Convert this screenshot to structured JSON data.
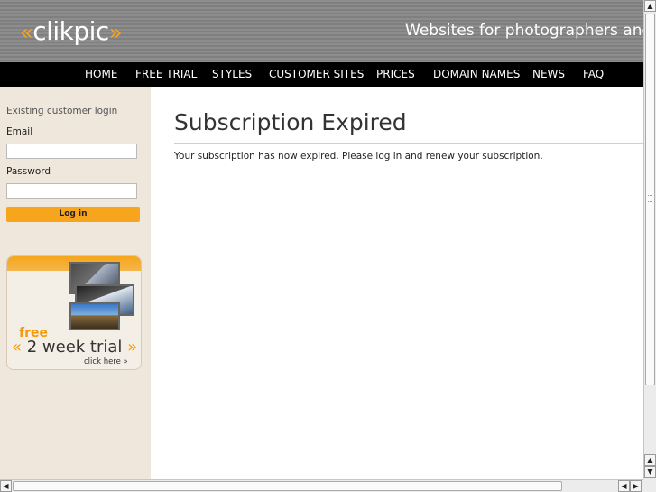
{
  "header": {
    "logo_open": "«",
    "logo_text": "clikpic",
    "logo_close": "»",
    "tagline": "Websites for photographers and"
  },
  "nav": [
    "HOME",
    "FREE TRIAL",
    "STYLES",
    "CUSTOMER SITES",
    "PRICES",
    "DOMAIN NAMES",
    "NEWS",
    "FAQ"
  ],
  "login": {
    "title": "Existing customer login",
    "email_label": "Email",
    "email_value": "",
    "password_label": "Password",
    "password_value": "",
    "button": "Log in"
  },
  "promo": {
    "free": "free",
    "open_quote": "«",
    "trial": " 2 week trial ",
    "close_quote": "»",
    "click": "click here »"
  },
  "main": {
    "title": "Subscription Expired",
    "message": "Your subscription has now expired. Please log in and renew your subscription."
  },
  "colors": {
    "accent": "#f6a51c",
    "nav_bg": "#000000",
    "sidebar_bg": "#efe6dc",
    "header_bg": "#8d8d8d"
  }
}
